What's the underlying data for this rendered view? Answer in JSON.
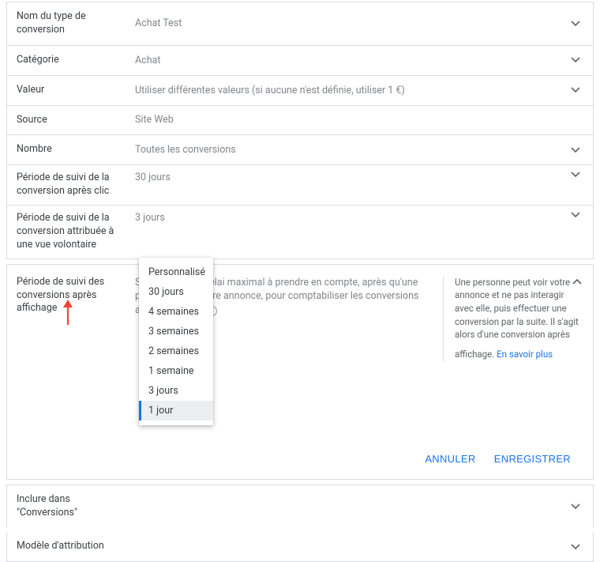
{
  "rows": [
    {
      "label": "Nom du type de conversion",
      "value": "Achat Test",
      "expandable": true
    },
    {
      "label": "Catégorie",
      "value": "Achat",
      "expandable": true
    },
    {
      "label": "Valeur",
      "value": "Utiliser différentes valeurs (si aucune n'est définie, utiliser 1 €)",
      "expandable": true
    },
    {
      "label": "Source",
      "value": "Site Web",
      "expandable": false
    },
    {
      "label": "Nombre",
      "value": "Toutes les conversions",
      "expandable": true
    },
    {
      "label": "Période de suivi de la conversion après clic",
      "value": "30 jours",
      "expandable": true
    },
    {
      "label": "Période de suivi de la conversion attribuée à une vue volontaire",
      "value": "3 jours",
      "expandable": true
    }
  ],
  "expanded": {
    "label": "Période de suivi des conversions après affichage",
    "description": "Sélectionnez le délai maximal à prendre en compte, après qu'une personne a vu votre annonce, pour comptabiliser les conversions après affichage",
    "help_text": "Une personne peut voir votre annonce et ne pas interagir avec elle, puis effectuer une conversion par la suite. Il s'agit alors d'une conversion après affichage.",
    "learn_more": "En savoir plus",
    "cancel": "ANNULER",
    "save": "ENREGISTRER"
  },
  "dropdown": {
    "options": [
      "Personnalisé",
      "30 jours",
      "4 semaines",
      "3 semaines",
      "2 semaines",
      "1 semaine",
      "3 jours",
      "1 jour"
    ],
    "selected_index": 7
  },
  "below": [
    {
      "label": "Inclure dans \"Conversions\""
    },
    {
      "label": "Modèle d'attribution"
    }
  ]
}
